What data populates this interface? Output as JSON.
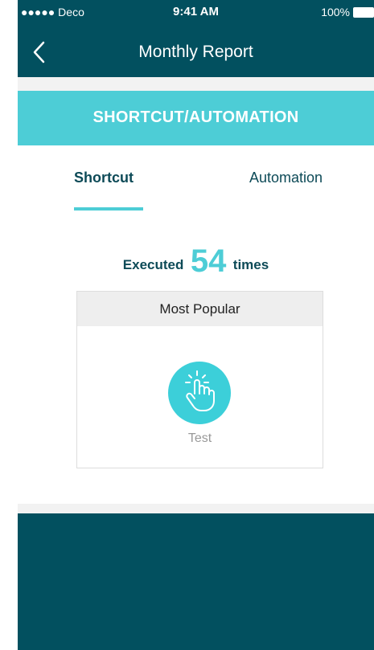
{
  "status_bar": {
    "carrier": "●●●●● Deco",
    "time": "9:41 AM",
    "battery": "100%"
  },
  "nav": {
    "title": "Monthly Report"
  },
  "banner": {
    "title": "SHORTCUT/AUTOMATION"
  },
  "tabs": [
    {
      "label": "Shortcut",
      "active": true
    },
    {
      "label": "Automation",
      "active": false
    }
  ],
  "summary": {
    "prefix": "Executed",
    "count": "54",
    "suffix": "times"
  },
  "card": {
    "header": "Most Popular",
    "item_label": "Test",
    "item_icon": "tap-hand-icon"
  },
  "colors": {
    "dark_teal": "#02505f",
    "accent_cyan": "#4dcdd6"
  }
}
